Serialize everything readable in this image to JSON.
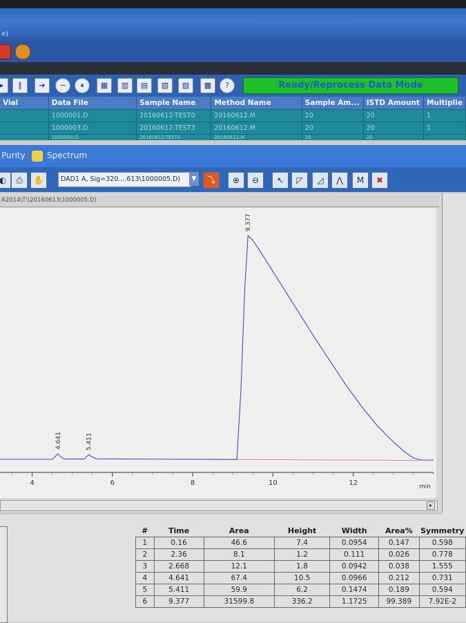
{
  "window": {
    "title": "e)"
  },
  "toolbar": {
    "status": "Ready/Reprocess Data Mode",
    "help": "?"
  },
  "sequence_table": {
    "columns": [
      "Vial",
      "Data File",
      "Sample Name",
      "Method Name",
      "Sample Am...",
      "ISTD Amount",
      "Multiplie"
    ],
    "rows": [
      [
        "",
        "1000001.D",
        "20160612-TEST0",
        "20160612.M",
        "20",
        "20",
        "1"
      ],
      [
        "",
        "1000003.D",
        "20160612-TEST3",
        "20160612.M",
        "20",
        "20",
        "1"
      ],
      [
        "",
        "1000004.D",
        "20160612-TEST4",
        "20160612.M",
        "20",
        "20",
        ""
      ]
    ]
  },
  "tabs": {
    "purity": "Purity",
    "spectrum": "Spectrum"
  },
  "signal": {
    "selected": "DAD1 A, Sig=320....613\\1000005.D)"
  },
  "chart_path": "A2014\\T\\\\20160613\\1000005.D)",
  "chart_data": {
    "type": "line",
    "xlabel": "min",
    "xlim": [
      3.2,
      14.0
    ],
    "x_ticks": [
      4,
      6,
      8,
      10,
      12
    ],
    "peak_labels": [
      {
        "time": 4.641,
        "label": "4.641"
      },
      {
        "time": 5.411,
        "label": "5.411"
      },
      {
        "time": 9.377,
        "label": "9.377"
      }
    ],
    "series": [
      {
        "color": "#3a4fc7",
        "points": [
          [
            3.2,
            0.6
          ],
          [
            4.5,
            0.6
          ],
          [
            4.56,
            1.5
          ],
          [
            4.64,
            3.0
          ],
          [
            4.72,
            1.5
          ],
          [
            4.8,
            0.7
          ],
          [
            5.3,
            0.7
          ],
          [
            5.36,
            1.8
          ],
          [
            5.41,
            2.6
          ],
          [
            5.5,
            1.6
          ],
          [
            5.6,
            0.8
          ],
          [
            9.1,
            0.5
          ],
          [
            9.2,
            30
          ],
          [
            9.3,
            75
          ],
          [
            9.377,
            97
          ],
          [
            9.5,
            95
          ],
          [
            9.8,
            87
          ],
          [
            10.2,
            76
          ],
          [
            10.6,
            65
          ],
          [
            11.0,
            54
          ],
          [
            11.4,
            43.5
          ],
          [
            11.8,
            33
          ],
          [
            12.2,
            23.5
          ],
          [
            12.6,
            15
          ],
          [
            13.0,
            8
          ],
          [
            13.3,
            3.5
          ],
          [
            13.5,
            1.2
          ],
          [
            13.7,
            0.3
          ],
          [
            14.0,
            0.2
          ]
        ]
      },
      {
        "color": "#e070c8",
        "points": [
          [
            9.1,
            0.55
          ],
          [
            14.0,
            0.1
          ]
        ]
      }
    ]
  },
  "peak_table": {
    "columns": [
      "#",
      "Time",
      "Area",
      "Height",
      "Width",
      "Area%",
      "Symmetry"
    ],
    "rows": [
      [
        "1",
        "0.16",
        "46.6",
        "7.4",
        "0.0954",
        "0.147",
        "0.598"
      ],
      [
        "2",
        "2.36",
        "8.1",
        "1.2",
        "0.111",
        "0.026",
        "0.778"
      ],
      [
        "3",
        "2.668",
        "12.1",
        "1.8",
        "0.0942",
        "0.038",
        "1.555"
      ],
      [
        "4",
        "4.641",
        "67.4",
        "10.5",
        "0.0966",
        "0.212",
        "0.731"
      ],
      [
        "5",
        "5.411",
        "59.9",
        "6.2",
        "0.1474",
        "0.189",
        "0.594"
      ],
      [
        "6",
        "9.377",
        "31599.8",
        "336.2",
        "1.1725",
        "99.389",
        "7.92E-2"
      ]
    ]
  }
}
